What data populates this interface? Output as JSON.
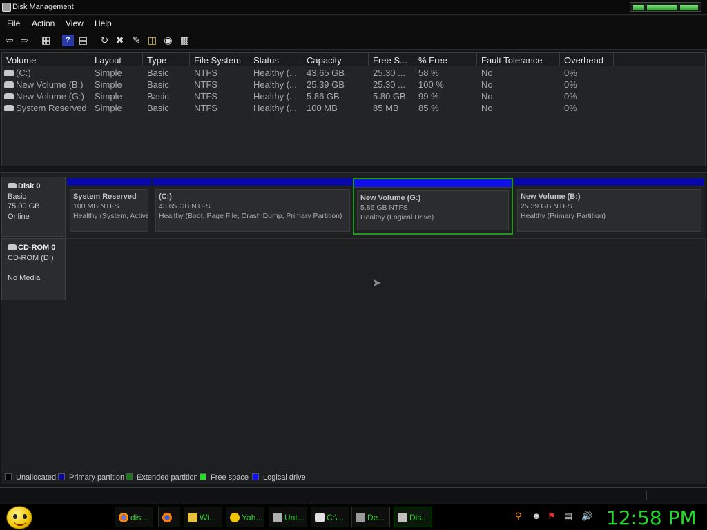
{
  "window": {
    "title": "Disk Management"
  },
  "menu": [
    "File",
    "Action",
    "View",
    "Help"
  ],
  "toolbar": [
    "back-icon",
    "forward-icon",
    "console-tree-icon",
    "help-icon",
    "properties-icon",
    "refresh-icon",
    "delete-icon",
    "rescan-icon",
    "open-icon",
    "explore-icon",
    "settings-icon"
  ],
  "volumes": {
    "columns": [
      "Volume",
      "Layout",
      "Type",
      "File System",
      "Status",
      "Capacity",
      "Free S...",
      "% Free",
      "Fault Tolerance",
      "Overhead"
    ],
    "rows": [
      [
        "(C:)",
        "Simple",
        "Basic",
        "NTFS",
        "Healthy (...",
        "43.65 GB",
        "25.30 ...",
        "58 %",
        "No",
        "0%"
      ],
      [
        "New Volume (B:)",
        "Simple",
        "Basic",
        "NTFS",
        "Healthy (...",
        "25.39 GB",
        "25.30 ...",
        "100 %",
        "No",
        "0%"
      ],
      [
        "New Volume (G:)",
        "Simple",
        "Basic",
        "NTFS",
        "Healthy (...",
        "5.86 GB",
        "5.80 GB",
        "99 %",
        "No",
        "0%"
      ],
      [
        "System Reserved",
        "Simple",
        "Basic",
        "NTFS",
        "Healthy (...",
        "100 MB",
        "85 MB",
        "85 %",
        "No",
        "0%"
      ]
    ]
  },
  "disks": {
    "disk0": {
      "name": "Disk 0",
      "type": "Basic",
      "size": "75.00 GB",
      "status": "Online"
    },
    "cdrom0": {
      "name": "CD-ROM 0",
      "drive": "CD-ROM (D:)",
      "media": "No Media"
    }
  },
  "partitions": [
    {
      "name": "System Reserved",
      "size": "100 MB NTFS",
      "status": "Healthy (System, Active, Primary Partition)"
    },
    {
      "name": "(C:)",
      "size": "43.65 GB NTFS",
      "status": "Healthy (Boot, Page File, Crash Dump, Primary Partition)"
    },
    {
      "name": "New Volume  (G:)",
      "size": "5.86 GB NTFS",
      "status": "Healthy (Logical Drive)"
    },
    {
      "name": "New Volume  (B:)",
      "size": "25.39 GB NTFS",
      "status": "Healthy (Primary Partition)"
    }
  ],
  "legend": [
    {
      "label": "Unallocated",
      "color": "#000000"
    },
    {
      "label": "Primary partition",
      "color": "#0a0a9a"
    },
    {
      "label": "Extended partition",
      "color": "#1a7a1a"
    },
    {
      "label": "Free space",
      "color": "#22e022"
    },
    {
      "label": "Logical drive",
      "color": "#1010ff"
    }
  ],
  "taskbar": {
    "tasks": [
      "dis...",
      "Wi...",
      "Yah...",
      "Unt...",
      "C:\\...",
      "De...",
      "Dis..."
    ],
    "clock": "12:58 PM"
  },
  "colors": {
    "accent": "#22d82a",
    "primary_bar": "#0808a8",
    "selected_border": "#1f9a1f"
  }
}
